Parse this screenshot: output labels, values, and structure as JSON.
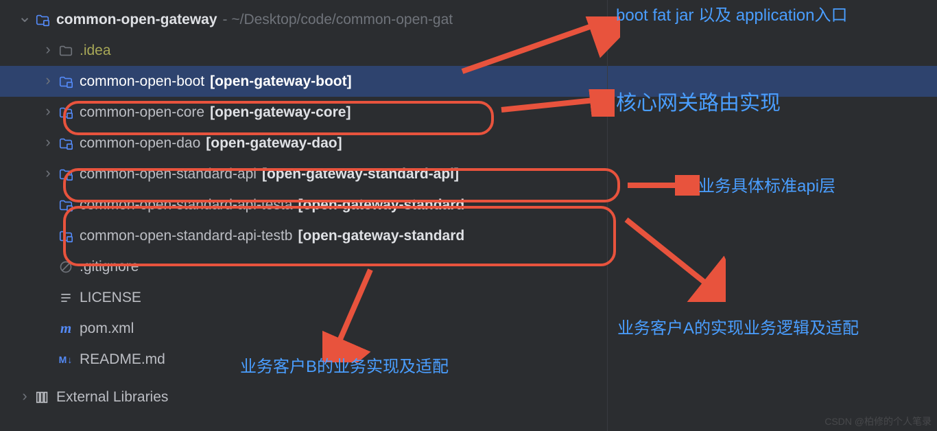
{
  "root": {
    "name": "common-open-gateway",
    "path": "- ~/Desktop/code/common-open-gat"
  },
  "nodes": {
    "idea": ".idea",
    "boot": "common-open-boot",
    "boot_bracket": "[open-gateway-boot]",
    "core": "common-open-core",
    "core_bracket": "[open-gateway-core]",
    "dao": "common-open-dao",
    "dao_bracket": "[open-gateway-dao]",
    "std_api": "common-open-standard-api",
    "std_api_bracket": "[open-gateway-standard-api]",
    "std_api_ta": "common-open-standard-api-testa",
    "std_api_ta_bracket": "[open-gateway-standard",
    "std_api_tb": "common-open-standard-api-testb",
    "std_api_tb_bracket": "[open-gateway-standard",
    "gitignore": ".gitignore",
    "license": "LICENSE",
    "pom": "pom.xml",
    "readme": "README.md",
    "ext_lib": "External Libraries"
  },
  "annotations": {
    "boot_app": "boot fat jar 以及 application入口",
    "core_gw": "核心网关路由实现",
    "std_api_layer": "业务具体标准api层",
    "client_a": "业务客户A的实现业务逻辑及适配",
    "client_b": "业务客户B的业务实现及适配"
  },
  "icons": {
    "pom_m": "m",
    "md_mark": "M↓"
  },
  "watermark": "CSDN @柏修的个人笔录"
}
